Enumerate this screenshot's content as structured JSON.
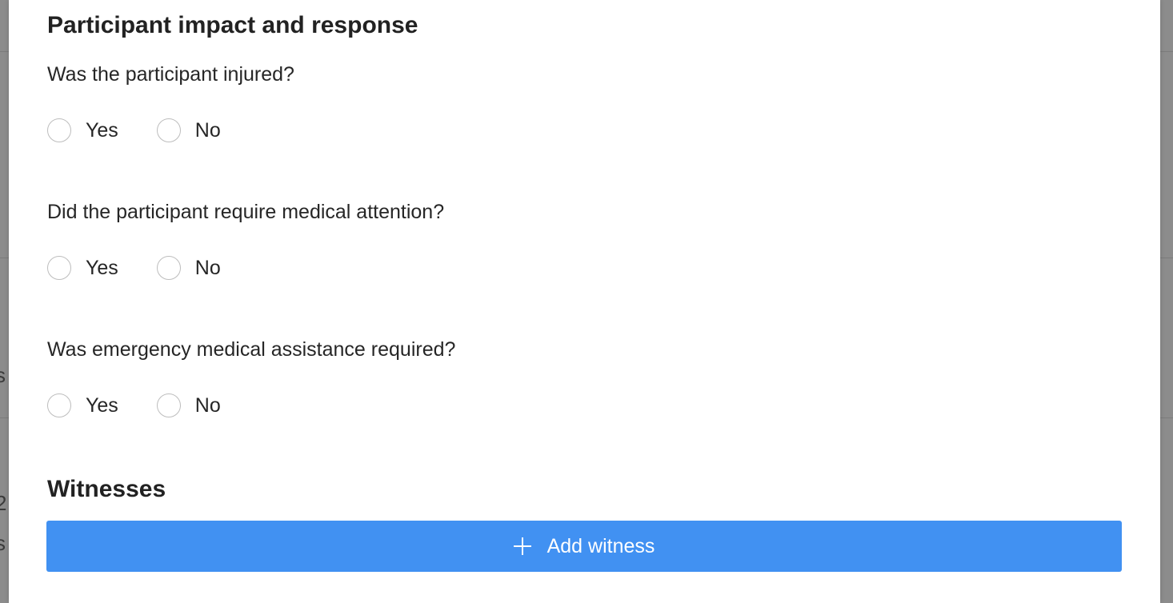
{
  "background": {
    "left_glyphs": [
      ":",
      "s",
      "2",
      "s"
    ]
  },
  "section_impact": {
    "title": "Participant impact and response",
    "questions": [
      {
        "text": "Was the participant injured?",
        "options": [
          "Yes",
          "No"
        ]
      },
      {
        "text": "Did the participant require medical attention?",
        "options": [
          "Yes",
          "No"
        ]
      },
      {
        "text": "Was emergency medical assistance required?",
        "options": [
          "Yes",
          "No"
        ]
      }
    ]
  },
  "section_witnesses": {
    "title": "Witnesses",
    "add_button_label": "Add witness"
  },
  "colors": {
    "primary_button": "#4191f2",
    "radio_border": "#bdbdbd",
    "overlay": "#8c8c8c"
  }
}
